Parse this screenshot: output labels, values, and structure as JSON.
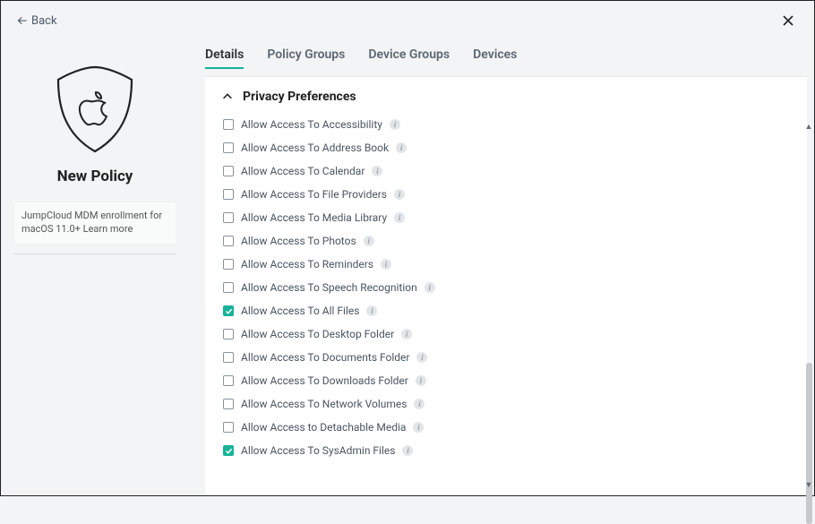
{
  "nav": {
    "back_label": "Back"
  },
  "sidebar": {
    "title": "New Policy",
    "note_text": "JumpCloud MDM enrollment for macOS 11.0+ ",
    "learn_more": "Learn more"
  },
  "tabs": [
    {
      "label": "Details",
      "active": true
    },
    {
      "label": "Policy Groups",
      "active": false
    },
    {
      "label": "Device Groups",
      "active": false
    },
    {
      "label": "Devices",
      "active": false
    }
  ],
  "section": {
    "title": "Privacy Preferences"
  },
  "options": [
    {
      "label": "Allow Access To Accessibility",
      "checked": false
    },
    {
      "label": "Allow Access To Address Book",
      "checked": false
    },
    {
      "label": "Allow Access To Calendar",
      "checked": false
    },
    {
      "label": "Allow Access To File Providers",
      "checked": false
    },
    {
      "label": "Allow Access To Media Library",
      "checked": false
    },
    {
      "label": "Allow Access To Photos",
      "checked": false
    },
    {
      "label": "Allow Access To Reminders",
      "checked": false
    },
    {
      "label": "Allow Access To Speech Recognition",
      "checked": false
    },
    {
      "label": "Allow Access To All Files",
      "checked": true
    },
    {
      "label": "Allow Access To Desktop Folder",
      "checked": false
    },
    {
      "label": "Allow Access To Documents Folder",
      "checked": false
    },
    {
      "label": "Allow Access To Downloads Folder",
      "checked": false
    },
    {
      "label": "Allow Access To Network Volumes",
      "checked": false
    },
    {
      "label": "Allow Access to Detachable Media",
      "checked": false
    },
    {
      "label": "Allow Access To SysAdmin Files",
      "checked": true
    }
  ]
}
